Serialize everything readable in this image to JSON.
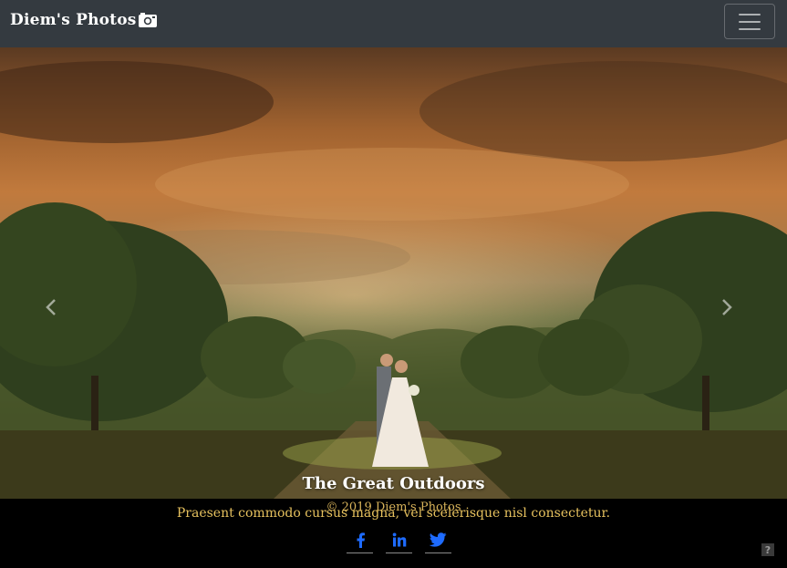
{
  "navbar": {
    "brand": "Diem's Photos",
    "toggler_label": ""
  },
  "hero": {
    "caption_title": "The Great Outdoors",
    "caption_text": "Praesent commodo cursus magna, vel scelerisque nisl consectetur.",
    "icons": {
      "prev": "chevron-left-icon",
      "next": "chevron-right-icon"
    }
  },
  "footer": {
    "copyright": "© 2019 Diem's Photos",
    "social": [
      {
        "name": "facebook-icon"
      },
      {
        "name": "linkedin-icon"
      },
      {
        "name": "twitter-icon"
      }
    ]
  },
  "help_label": "?",
  "colors": {
    "navbar": "#343a40",
    "caption_accent": "#e6c15e",
    "social": "#1e6bff"
  }
}
